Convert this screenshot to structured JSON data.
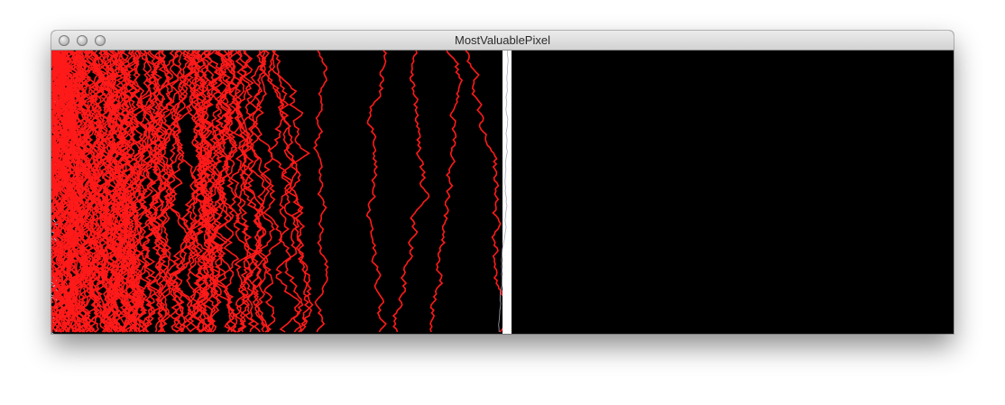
{
  "window": {
    "title": "MostValuablePixel"
  },
  "icons": {
    "close": "close-button-icon",
    "minimize": "minimize-button-icon",
    "zoom": "zoom-button-icon"
  },
  "colors": {
    "background": "#000000",
    "trace": "#ff1a1a",
    "divider": "#ffffff",
    "edge_noise": "#cfcfe8"
  }
}
